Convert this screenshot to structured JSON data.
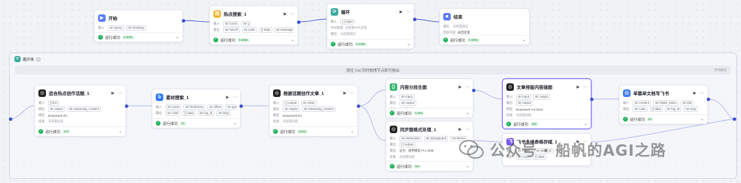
{
  "status": {
    "ok_label": "运行成功"
  },
  "nodes": {
    "start": {
      "title": "开始",
      "input_label": "输入",
      "params": [
        "str query",
        "str shuliang"
      ],
      "time": "0.000s"
    },
    "hot_search": {
      "title": "热点搜索_1",
      "row1_label": "输入",
      "row1": [
        "str count",
        "str q"
      ],
      "row2_label": "输出",
      "row2": [
        "str hasAll",
        "str code",
        "{} data",
        "str message"
      ],
      "time": "0.605s"
    },
    "loop": {
      "title": "循环",
      "row1_label": "输入",
      "row1": [
        "[ ] input"
      ],
      "row2_label": "中间变量",
      "row2_text": "未配置中间变量",
      "row3_label": "输出",
      "row3_text": "未配置输出",
      "time": "0.038s"
    },
    "end": {
      "title": "结束",
      "row1_label": "输出",
      "row1_text": "未配置输出",
      "row2_label": "回答内容",
      "row2_text": "返回变量",
      "time": "0.000s"
    },
    "topic": {
      "title": "适合热点创作话题_1",
      "row1_label": "输入",
      "row1": [
        "{} list"
      ],
      "row2_label": "输出",
      "row2": [
        "str output",
        "str reasoning_content"
      ],
      "row3_label": "模型",
      "row3_text": "DeepSeek-R1",
      "row4_label": "技能",
      "row4_text": "未配置技能",
      "time": "27s"
    },
    "material": {
      "title": "素材搜索_1",
      "row1_label": "输入",
      "row1": [
        "str count",
        "str freshness",
        "str offset",
        "str query"
      ],
      "row2_label": "输出",
      "row2": [
        "str code",
        "{} data",
        "str log_id",
        "str msg"
      ],
      "time": "1s"
    },
    "article": {
      "title": "根据话题创作文章_1",
      "row1_label": "输入",
      "row1": [
        "[ ] output",
        "str value"
      ],
      "row2_label": "输出",
      "row2": [
        "str output",
        "str reasoning_content"
      ],
      "row3_label": "模型",
      "row3_text": "DeepSeek-R1",
      "row4_label": "技能",
      "row4_text": "未配置技能",
      "time": "1m6s"
    },
    "content_split": {
      "title": "内容分段生图",
      "row1_label": "输入",
      "row1": [
        "str input"
      ],
      "row2_label": "输出",
      "row2": [
        "str output"
      ],
      "row3_label": "技能",
      "row3_text": "未配置技能",
      "time": "0.68s"
    },
    "sync_format": {
      "title": "同步图格式处理_1",
      "row1_label": "输入",
      "row1": [
        "str reDenoise",
        "str aiDngboard",
        "str theme"
      ],
      "row2_label": "输出",
      "row2": [
        "[ ] output"
      ],
      "row3_label": "模型",
      "row3_text": "豆包 · 通用模型 Pro 256k",
      "row4_label": "技能",
      "row4_text": "未配置技能",
      "time": "9m"
    },
    "layout_image": {
      "title": "文章排版内容插图",
      "row1_label": "输入",
      "row1": [
        "str input",
        "str output"
      ],
      "row2_label": "输出",
      "row2": [
        "str output"
      ],
      "row3_label": "模型",
      "row3_text": "DeepSeek-V3-0324",
      "row4_label": "技能",
      "row4_text": "未配置技能",
      "time": "28s"
    },
    "feishu_table": {
      "title": "飞书多维表格存储_1",
      "row1_label": "输入",
      "row1": [
        "str name",
        "str table_id"
      ],
      "row2_label": "输出",
      "row2": [
        "str code",
        "{} data"
      ],
      "time": ""
    },
    "feishu_doc": {
      "title": "单篇单文档写飞书",
      "row1_label": "输入",
      "row1": [
        "str content",
        "str folder_token",
        "str title"
      ],
      "row2_label": "输出",
      "row2": [
        "str code",
        "{} data",
        "str log_id",
        "str msg"
      ],
      "time": "8s"
    }
  },
  "loop_body": {
    "title": "循环体",
    "hint": "按住 Ctrl 同时拖拽节点即可拖出",
    "hint_right": "手势模式"
  },
  "watermark": {
    "text": "公众号 · 船帆的AGI之路"
  },
  "colors": {
    "wire": "#3d4fd6",
    "ok": "#1fb35b",
    "selected": "#8f84f7"
  },
  "icons": {
    "start": "play-icon",
    "hot_search": "search-plugin-icon",
    "loop": "loop-icon",
    "end": "stop-icon",
    "topic": "llm-icon",
    "material": "bing-icon",
    "article": "llm-icon",
    "content_split": "code-icon",
    "sync_format": "llm-icon",
    "layout_image": "llm-icon",
    "feishu_table": "feishu-icon",
    "feishu_doc": "doc-icon"
  }
}
